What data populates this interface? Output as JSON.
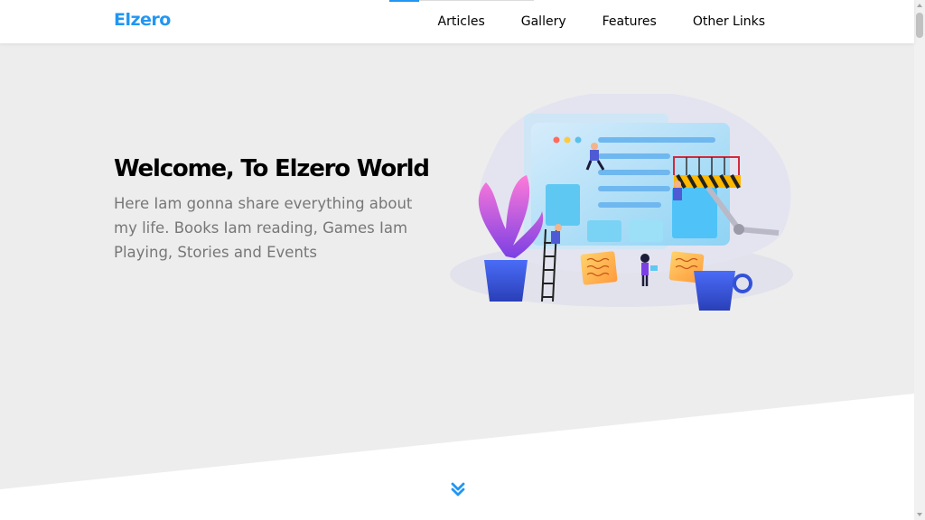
{
  "brand": {
    "logo_text": "Elzero",
    "accent_color": "#2196f3"
  },
  "nav": {
    "items": [
      {
        "label": "Articles"
      },
      {
        "label": "Gallery"
      },
      {
        "label": "Features"
      },
      {
        "label": "Other Links"
      }
    ]
  },
  "hero": {
    "title": "Welcome, To Elzero World",
    "text": "Here Iam gonna share everything about my life. Books Iam reading, Games Iam Playing, Stories and Events",
    "illustration": "team-building-website-illustration",
    "scroll_icon": "double-chevron-down-icon"
  }
}
